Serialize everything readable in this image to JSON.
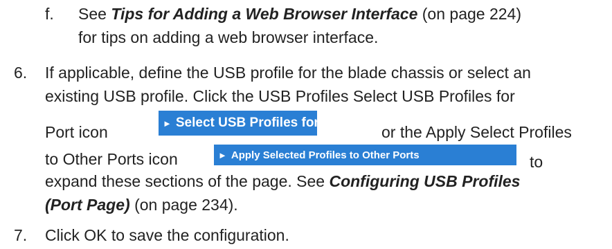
{
  "step_f": {
    "marker": "f.",
    "prefix": "See ",
    "link": "Tips for Adding a Web Browser Interface",
    "suffix": " (on page 224)",
    "line2": "for tips on adding a web browser interface."
  },
  "step_6": {
    "marker": "6.",
    "line1": "If applicable, define the USB profile for the blade chassis or select an",
    "line2": "existing USB profile. Click the USB Profiles Select USB Profiles for",
    "line3a": "Port icon",
    "line3b": "or the Apply Select Profiles",
    "line4a": "to Other Ports icon",
    "line4b": "to",
    "line5a": "expand these sections of the page. See ",
    "link_part1": "Configuring USB Profiles",
    "link_part2": "(Port Page)",
    "line6b": " (on page 234)."
  },
  "buttons": {
    "select_usb": {
      "arrow": "►",
      "label": "Select USB Profiles for Port"
    },
    "apply_selected": {
      "arrow": "►",
      "label": "Apply Selected Profiles to Other Ports"
    }
  },
  "step_7": {
    "marker": "7.",
    "text": "Click OK to save the configuration."
  },
  "colors": {
    "button_blue": "#2a7fd4",
    "text": "#222222"
  }
}
